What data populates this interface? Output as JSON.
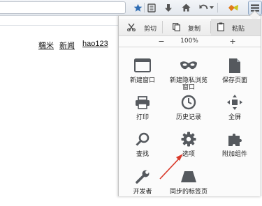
{
  "toolbar": {
    "icons": [
      "star-icon",
      "bookmark-list-icon",
      "download-icon",
      "home-icon",
      "undo-icon",
      "chevron-down-icon",
      "addon-icon",
      "hamburger-menu-icon"
    ]
  },
  "page": {
    "links": [
      "糯米",
      "新闻",
      "hao123"
    ]
  },
  "menu": {
    "edit": {
      "cut": "剪切",
      "copy": "复制",
      "paste": "粘贴"
    },
    "zoom": {
      "minus": "−",
      "value": "100%",
      "plus": "+"
    },
    "items": [
      {
        "label": "新建窗口",
        "icon": "window-icon"
      },
      {
        "label": "新建隐私浏览窗口",
        "icon": "mask-icon"
      },
      {
        "label": "保存页面",
        "icon": "page-icon"
      },
      {
        "label": "打印",
        "icon": "printer-icon"
      },
      {
        "label": "历史记录",
        "icon": "clock-icon"
      },
      {
        "label": "全屏",
        "icon": "fullscreen-icon"
      },
      {
        "label": "查找",
        "icon": "magnifier-icon"
      },
      {
        "label": "选项",
        "icon": "gear-icon"
      },
      {
        "label": "附加组件",
        "icon": "puzzle-icon"
      },
      {
        "label": "开发者",
        "icon": "wrench-icon"
      },
      {
        "label": "同步的标签页",
        "icon": "sync-tabs-icon"
      }
    ]
  },
  "colors": {
    "accent_blue": "#2f6db3",
    "icon_gray": "#55595e",
    "arrow_red": "#d93a2b"
  }
}
